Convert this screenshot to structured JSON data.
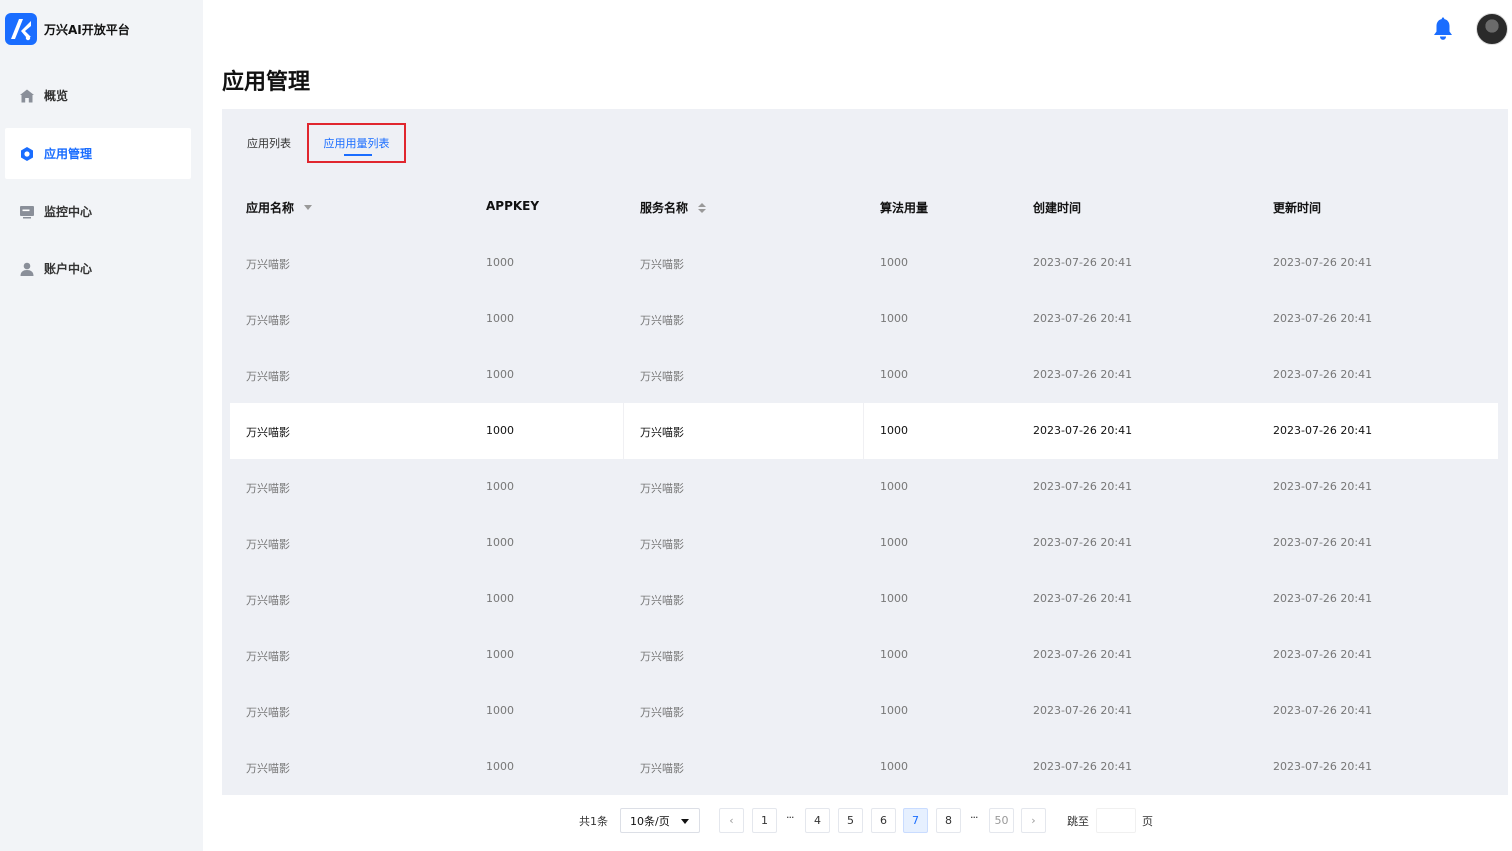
{
  "app": {
    "title": "万兴AI开放平台"
  },
  "colors": {
    "accent": "#1a6dff",
    "sidebar_bg": "#f2f4f7",
    "panel_bg": "#eef0f5",
    "highlight_border": "#e0262e"
  },
  "sidebar": {
    "items": [
      {
        "label": "概览",
        "icon": "home-icon",
        "active": false
      },
      {
        "label": "应用管理",
        "icon": "app-hexagon-icon",
        "active": true
      },
      {
        "label": "监控中心",
        "icon": "monitor-icon",
        "active": false
      },
      {
        "label": "账户中心",
        "icon": "user-icon",
        "active": false
      }
    ]
  },
  "header": {
    "bell_icon": "bell-icon",
    "avatar_icon": "avatar"
  },
  "main": {
    "title": "应用管理",
    "tabs": [
      {
        "label": "应用列表",
        "selected": false
      },
      {
        "label": "应用用量列表",
        "selected": true
      }
    ],
    "table": {
      "columns": [
        "应用名称",
        "APPKEY",
        "服务名称",
        "算法用量",
        "创建时间",
        "更新时间"
      ],
      "rows": [
        [
          "万兴喵影",
          "1000",
          "万兴喵影",
          "1000",
          "2023-07-26 20:41",
          "2023-07-26 20:41"
        ],
        [
          "万兴喵影",
          "1000",
          "万兴喵影",
          "1000",
          "2023-07-26 20:41",
          "2023-07-26 20:41"
        ],
        [
          "万兴喵影",
          "1000",
          "万兴喵影",
          "1000",
          "2023-07-26 20:41",
          "2023-07-26 20:41"
        ],
        [
          "万兴喵影",
          "1000",
          "万兴喵影",
          "1000",
          "2023-07-26 20:41",
          "2023-07-26 20:41"
        ],
        [
          "万兴喵影",
          "1000",
          "万兴喵影",
          "1000",
          "2023-07-26 20:41",
          "2023-07-26 20:41"
        ],
        [
          "万兴喵影",
          "1000",
          "万兴喵影",
          "1000",
          "2023-07-26 20:41",
          "2023-07-26 20:41"
        ],
        [
          "万兴喵影",
          "1000",
          "万兴喵影",
          "1000",
          "2023-07-26 20:41",
          "2023-07-26 20:41"
        ],
        [
          "万兴喵影",
          "1000",
          "万兴喵影",
          "1000",
          "2023-07-26 20:41",
          "2023-07-26 20:41"
        ],
        [
          "万兴喵影",
          "1000",
          "万兴喵影",
          "1000",
          "2023-07-26 20:41",
          "2023-07-26 20:41"
        ],
        [
          "万兴喵影",
          "1000",
          "万兴喵影",
          "1000",
          "2023-07-26 20:41",
          "2023-07-26 20:41"
        ]
      ],
      "highlighted_row_index": 3
    }
  },
  "pagination": {
    "total_label": "共1条",
    "page_size_label": "10条/页",
    "pages": [
      "1",
      "4",
      "5",
      "6",
      "7",
      "8",
      "50"
    ],
    "current_page": "7",
    "ellipsis": "···",
    "prev_icon": "chevron-left-icon",
    "next_icon": "chevron-right-icon",
    "prev_glyph": "‹",
    "next_glyph": "›",
    "jump_label": "跳至",
    "page_label": "页"
  }
}
